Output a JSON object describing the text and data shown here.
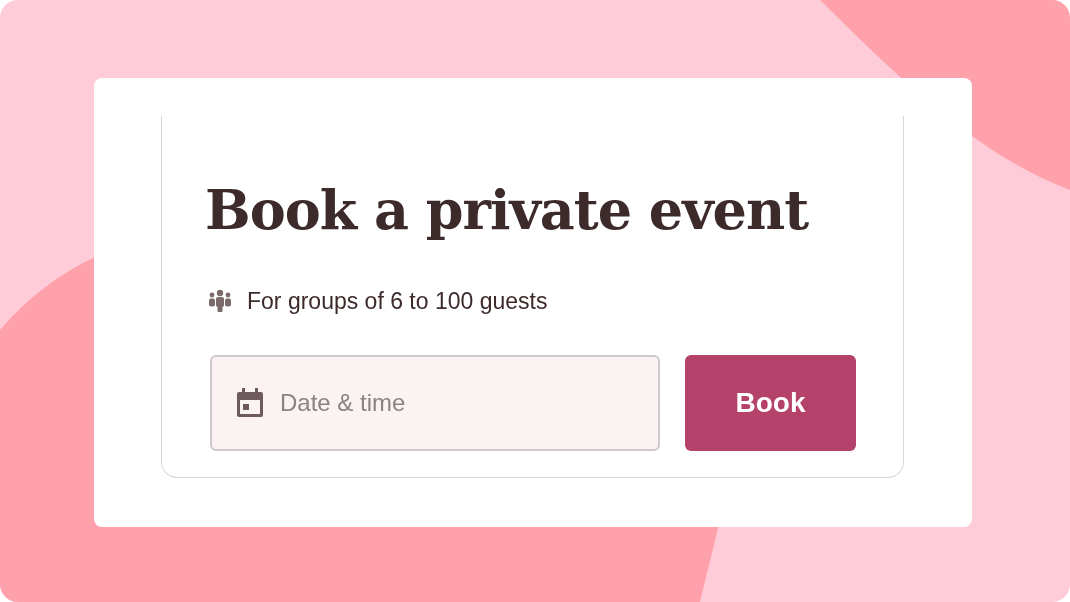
{
  "heading": "Book a private event",
  "note": "For groups of 6 to 100 guests",
  "date_field": {
    "placeholder": "Date & time"
  },
  "book_button": {
    "label": "Book"
  }
}
